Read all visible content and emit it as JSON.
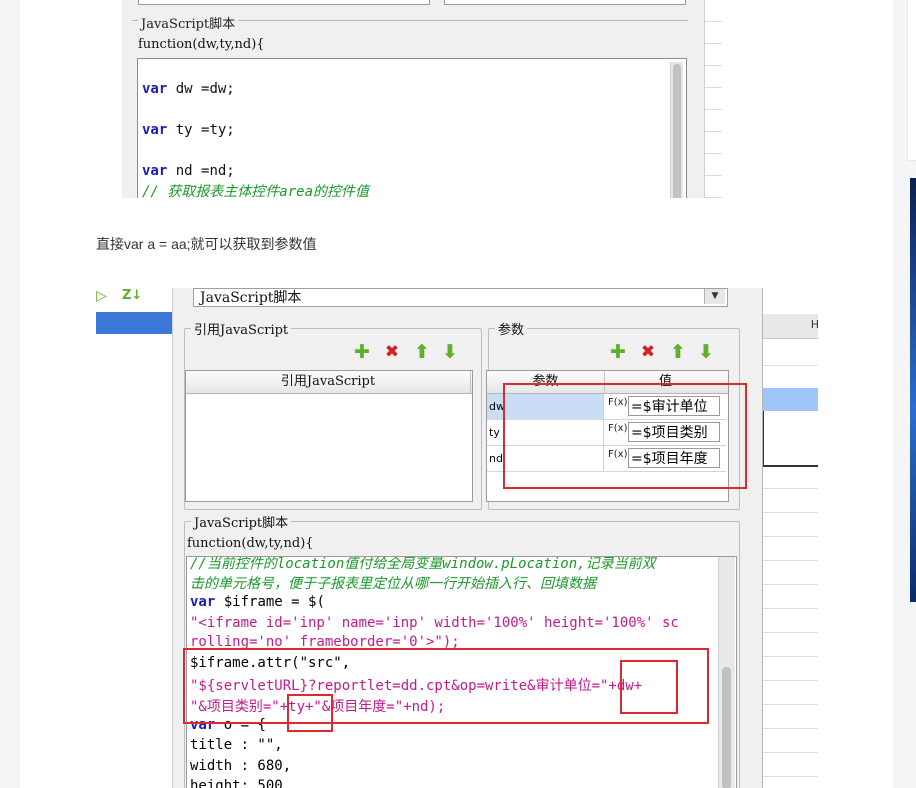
{
  "shot1": {
    "group_title": "JavaScript脚本",
    "signature": "function(dw,ty,nd){",
    "lines": [
      {
        "kw": "var",
        "rest": " dw =dw;"
      },
      {
        "kw": "var",
        "rest": " ty =ty;"
      },
      {
        "kw": "var",
        "rest": " nd =nd;"
      }
    ],
    "comment": "// 获取报表主体控件area的控件值"
  },
  "caption": "直接var a = aa;就可以获取到参数值",
  "shot2": {
    "script_type": "JavaScript脚本",
    "ref_group_title": "引用JavaScript",
    "ref_column": "引用JavaScript",
    "param_group_title": "参数",
    "param_headers": {
      "name": "参数",
      "value": "值"
    },
    "params": [
      {
        "name": "dw",
        "fx": "F(x)",
        "value": "=$审计单位"
      },
      {
        "name": "ty",
        "fx": "F(x)",
        "value": "=$项目类别"
      },
      {
        "name": "nd",
        "fx": "F(x)",
        "value": "=$项目年度"
      }
    ],
    "right_header": "H",
    "script_group_title": "JavaScript脚本",
    "signature": "function(dw,ty,nd){",
    "code": {
      "c1": "//当前控件的location值付给全局变量window.pLocation,记录当前双",
      "c2": "击的单元格号，便于子报表里定位从哪一行开始插入行、回填数据",
      "l3_kw": "var",
      "l3_rest": " $iframe = $(",
      "l4": "\"<iframe id='inp' name='inp' width='100%' height='100%' sc",
      "l5": "rolling='no' frameborder='0'>\");",
      "l6": "$iframe.attr(\"src\",",
      "l7": "\"${servletURL}?reportlet=dd.cpt&op=write&审计单位=\"+dw+",
      "l8": "\"&项目类别=\"+ty+\"&项目年度=\"+nd);",
      "l9_kw": "var",
      "l9_rest": " o = {",
      "l10": "title : \"\",",
      "l11": "width : 680,",
      "l12": "height: 500"
    }
  }
}
